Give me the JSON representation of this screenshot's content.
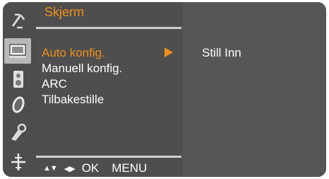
{
  "menu": {
    "title": "Skjerm",
    "items": [
      {
        "label": "Auto konfig.",
        "active": true
      },
      {
        "label": "Manuell konfig.",
        "active": false
      },
      {
        "label": "ARC",
        "active": false
      },
      {
        "label": "Tilbakestille",
        "active": false
      }
    ],
    "submenu_arrow": "right-arrow-icon"
  },
  "submenu": {
    "items": [
      {
        "label": "Still Inn"
      }
    ]
  },
  "footer": {
    "nav_up_down": "▲▼",
    "nav_left_right": "◀▶",
    "ok_label": "OK",
    "menu_label": "MENU"
  },
  "sidebar": {
    "icons": [
      "satellite-dish-icon",
      "screen-icon",
      "speaker-icon",
      "clock-icon",
      "lock-icon",
      "input-plug-icon"
    ],
    "selected": "screen-icon"
  },
  "colors": {
    "accent": "#f0901a",
    "background": "#4a4a4a",
    "text": "#ffffff"
  }
}
